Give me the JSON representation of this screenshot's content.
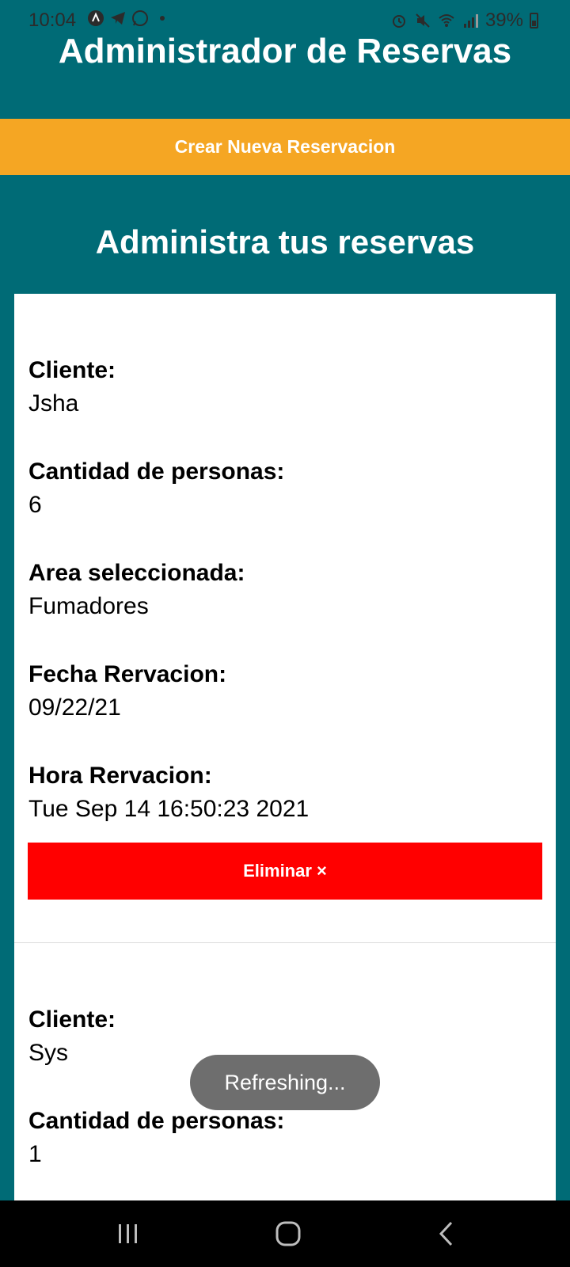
{
  "status": {
    "time": "10:04",
    "battery": "39%"
  },
  "header": {
    "title": "Administrador de Reservas"
  },
  "actions": {
    "create_label": "Crear Nueva Reservacion"
  },
  "main": {
    "section_title": "Administra tus reservas"
  },
  "labels": {
    "client": "Cliente:",
    "people": "Cantidad de personas:",
    "area": "Area seleccionada:",
    "date": "Fecha Rervacion:",
    "time": "Hora Rervacion:"
  },
  "reservations": [
    {
      "client": "Jsha",
      "people": "6",
      "area": "Fumadores",
      "date": "09/22/21",
      "time": "Tue Sep 14 16:50:23 2021",
      "delete_label": "Eliminar ×"
    },
    {
      "client": "Sys",
      "people": "1"
    }
  ],
  "toast": {
    "text": "Refreshing..."
  }
}
